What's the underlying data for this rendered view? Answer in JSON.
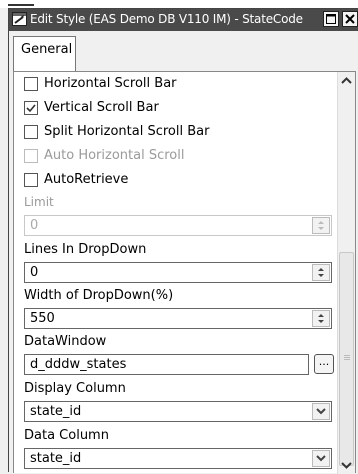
{
  "window": {
    "title": "Edit Style (EAS Demo DB V110 IM) - StateCode"
  },
  "tabs": [
    {
      "label": "General",
      "active": true
    }
  ],
  "checkboxes": [
    {
      "label": "Horizontal Scroll Bar",
      "checked": false,
      "enabled": true
    },
    {
      "label": "Vertical Scroll Bar",
      "checked": true,
      "enabled": true
    },
    {
      "label": "Split Horizontal Scroll Bar",
      "checked": false,
      "enabled": true
    },
    {
      "label": "Auto Horizontal Scroll",
      "checked": false,
      "enabled": false
    },
    {
      "label": "AutoRetrieve",
      "checked": false,
      "enabled": true
    }
  ],
  "fields": {
    "limit": {
      "label": "Limit",
      "value": "0",
      "enabled": false
    },
    "lines_in_dropdown": {
      "label": "Lines In DropDown",
      "value": "0"
    },
    "width_of_dropdown": {
      "label": "Width of DropDown(%)",
      "value": "550"
    },
    "datawindow": {
      "label": "DataWindow",
      "value": "d_dddw_states",
      "browse_label": "..."
    },
    "display_column": {
      "label": "Display Column",
      "value": "state_id"
    },
    "data_column": {
      "label": "Data Column",
      "value": "state_id"
    }
  },
  "colors": {
    "titlebar": "#4a4a4a",
    "background": "#f0f0f0",
    "disabled_text": "#9a9a9a"
  },
  "icons": [
    "window-icon",
    "maximize-icon",
    "close-icon",
    "scroll-up-icon",
    "scroll-down-icon",
    "checkmark-icon",
    "spin-arrows-icon",
    "dropdown-arrow-icon"
  ]
}
